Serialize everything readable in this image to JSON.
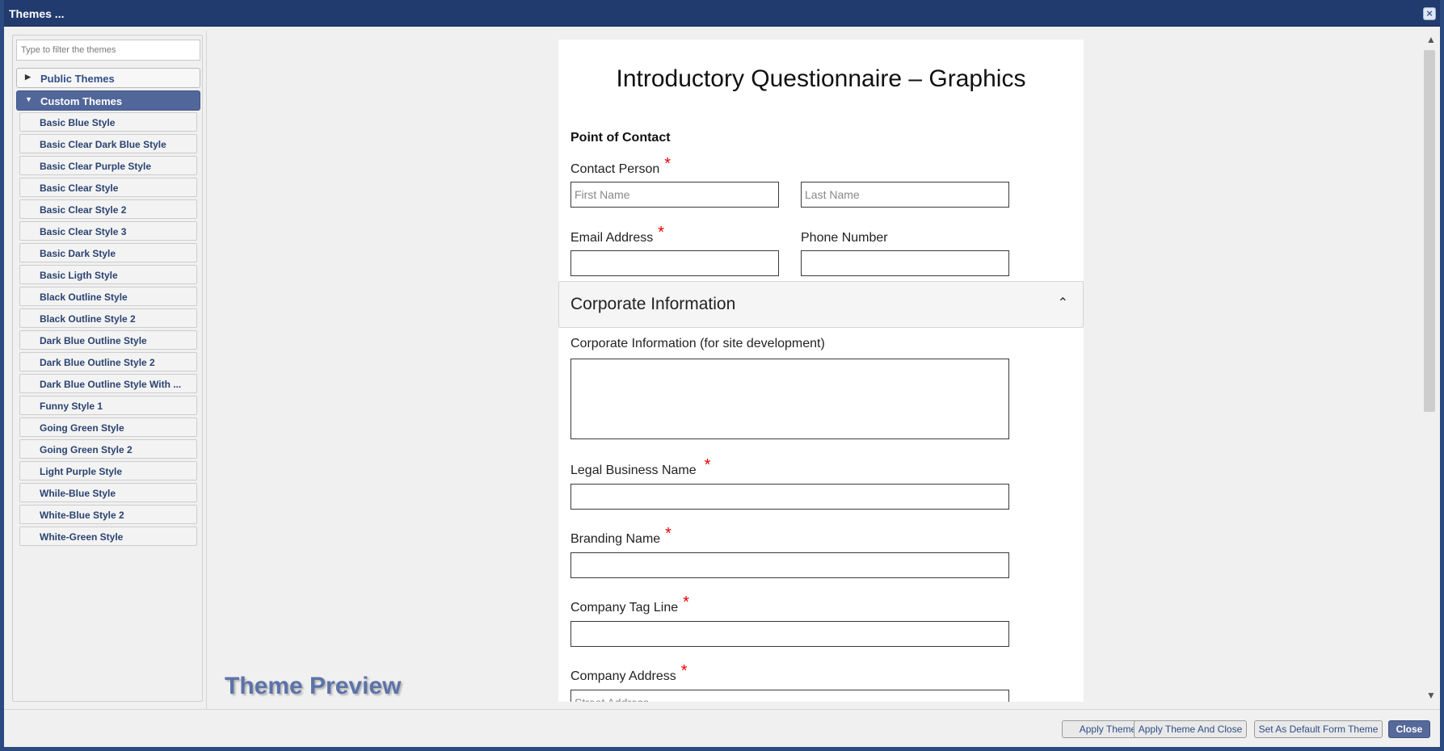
{
  "window": {
    "title": "Themes ...",
    "close_icon": "×"
  },
  "sidebar": {
    "filter_placeholder": "Type to filter the themes",
    "groups": [
      {
        "label": "Public Themes",
        "expanded": false,
        "arrow": "▶"
      },
      {
        "label": "Custom Themes",
        "expanded": true,
        "arrow": "▼"
      }
    ],
    "themes": [
      "Basic Blue Style",
      "Basic Clear Dark Blue Style",
      "Basic Clear Purple Style",
      "Basic Clear Style",
      "Basic Clear Style 2",
      "Basic Clear Style 3",
      "Basic Dark Style",
      "Basic Ligth Style",
      "Black Outline Style",
      "Black Outline Style 2",
      "Dark Blue Outline Style",
      "Dark Blue Outline Style 2",
      "Dark Blue Outline Style With ...",
      "Funny Style 1",
      "Going Green Style",
      "Going Green Style 2",
      "Light Purple Style",
      "While-Blue Style",
      "White-Blue Style 2",
      "White-Green Style"
    ]
  },
  "preview": {
    "watermark": "Theme Preview",
    "scroll_up": "▲",
    "scroll_down": "▼",
    "form": {
      "title": "Introductory Questionnaire – Graphics",
      "section_point_of_contact": "Point of Contact",
      "contact_person_label": "Contact Person",
      "first_name_placeholder": "First Name",
      "last_name_placeholder": "Last Name",
      "email_label": "Email Address",
      "phone_label": "Phone Number",
      "corporate_section_title": "Corporate Information",
      "corporate_chevron": "⌃",
      "corporate_info_label": "Corporate Information (for site development)",
      "legal_business_name_label": "Legal Business Name",
      "branding_name_label": "Branding Name",
      "company_tag_line_label": "Company Tag Line",
      "company_address_label": "Company Address",
      "street_address_placeholder": "Street Address",
      "required_mark": "*"
    }
  },
  "footer": {
    "buttons": [
      "Apply Theme",
      "Apply Theme And Close",
      "Set As Default Form Theme",
      "Close"
    ]
  },
  "colors": {
    "titlebar": "#223b6e",
    "selected_group": "#51679a",
    "primary_button": "#56699b",
    "required": "#e60000"
  }
}
